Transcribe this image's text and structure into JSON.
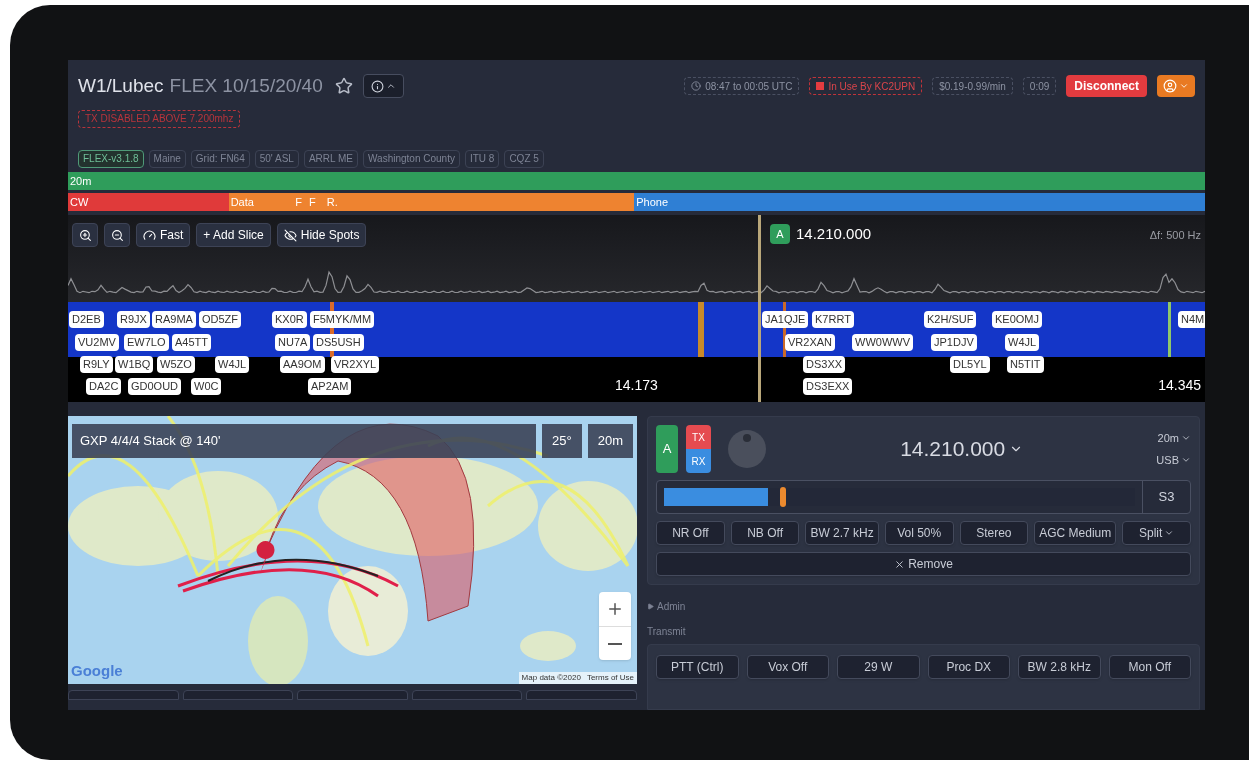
{
  "header": {
    "station": "W1/Lubec",
    "antennas": "FLEX 10/15/20/40",
    "warning": "TX DISABLED ABOVE 7.200mhz",
    "tags": [
      {
        "label": "FLEX-v3.1.8",
        "kind": "version"
      },
      {
        "label": "Maine",
        "kind": "info"
      },
      {
        "label": "Grid: FN64",
        "kind": "info"
      },
      {
        "label": "50' ASL",
        "kind": "info"
      },
      {
        "label": "ARRL ME",
        "kind": "info"
      },
      {
        "label": "Washington County",
        "kind": "info"
      },
      {
        "label": "ITU 8",
        "kind": "info"
      },
      {
        "label": "CQZ 5",
        "kind": "info"
      }
    ],
    "schedule": "08:47 to 00:05 UTC",
    "in_use": "In Use By KC2UPN",
    "rate": "$0.19-0.99/min",
    "elapsed": "0:09",
    "disconnect": "Disconnect"
  },
  "band": {
    "name": "20m",
    "segments": [
      {
        "label": "CW",
        "color": "#e03a3a"
      },
      {
        "label": "Data",
        "color": "#ee8330"
      },
      {
        "label": "F",
        "color": "#ee8330"
      },
      {
        "label": "F",
        "color": "#ee8330"
      },
      {
        "label": "R.",
        "color": "#ee8330"
      },
      {
        "label": "Phone",
        "color": "#2f7fd4"
      }
    ]
  },
  "panadapter": {
    "toolbar": [
      "Fast",
      "+ Add Slice",
      "Hide Spots"
    ],
    "slice": {
      "letter": "A",
      "frequency": "14.210.000"
    },
    "delta": "Δf: 500 Hz",
    "freq_labels": [
      "14.173",
      "14.345"
    ],
    "spots": [
      [
        "D2EB",
        "R9JX",
        "RA9MA",
        "OD5ZF",
        "KX0R",
        "F5MYK/MM",
        "JA1QJE",
        "K7RRT",
        "K2H/SUF",
        "KE0OMJ",
        "N4M"
      ],
      [
        "VU2MV",
        "EW7LO",
        "A45TT",
        "NU7A",
        "DS5USH",
        "VR2XAN",
        "WW0WWV",
        "JP1DJV",
        "W4JL"
      ],
      [
        "R9LY",
        "W1BQ",
        "W5ZO",
        "W4JL",
        "AA9OM",
        "VR2XYL",
        "DS3XX",
        "DL5YL",
        "N5TIT"
      ],
      [
        "DA2C",
        "GD0OUD",
        "W0C",
        "AP2AM",
        "DS3EXX"
      ]
    ]
  },
  "map": {
    "antenna": "GXP 4/4/4 Stack @ 140'",
    "elevation": "25°",
    "band": "20m",
    "logo": "Google",
    "attribution": "Map data ©2020",
    "terms": "Terms of Use"
  },
  "slice": {
    "letter": "A",
    "tx": "TX",
    "rx": "RX",
    "frequency": "14.210.000",
    "band": "20m",
    "mode": "USB",
    "meter": {
      "level": 0.22,
      "reading": "S3"
    },
    "buttons": [
      "NR Off",
      "NB Off",
      "BW 2.7 kHz",
      "Vol 50%",
      "Stereo",
      "AGC Medium",
      "Split"
    ],
    "remove": "Remove"
  },
  "admin": {
    "label": "Admin",
    "expanded": false
  },
  "transmit": {
    "label": "Transmit",
    "buttons": [
      "PTT (Ctrl)",
      "Vox Off",
      "29 W",
      "Proc DX",
      "BW 2.8 kHz",
      "Mon Off"
    ]
  }
}
